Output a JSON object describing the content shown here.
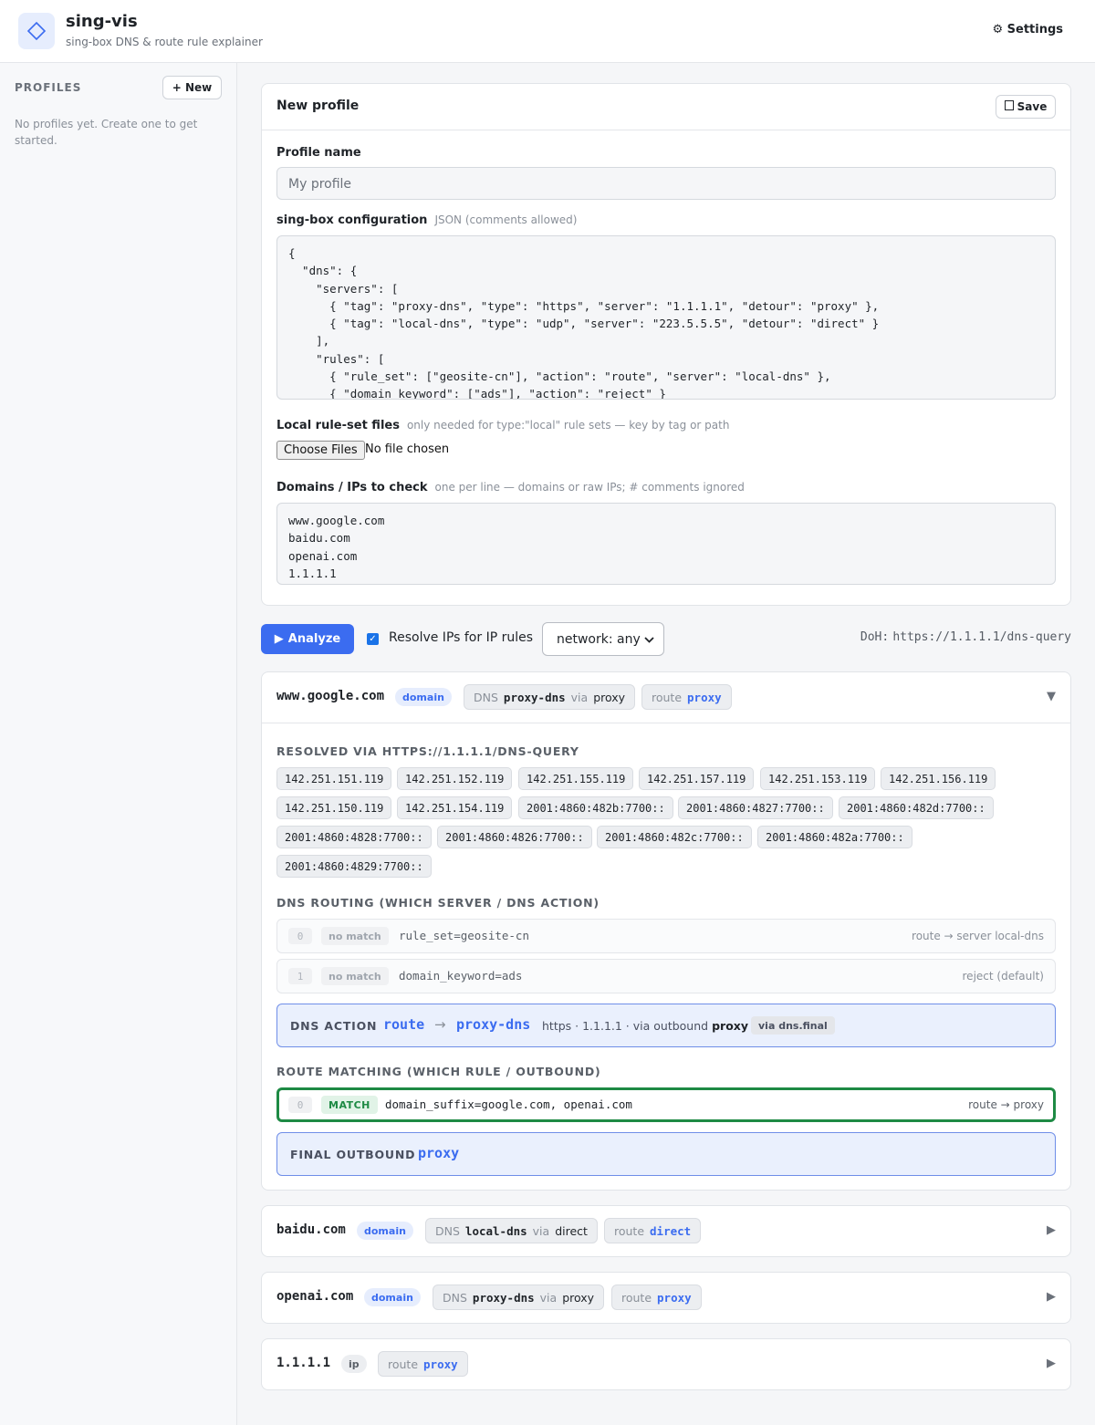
{
  "app": {
    "title": "sing-vis",
    "subtitle": "sing-box DNS & route rule explainer",
    "settings_label": "⚙ Settings",
    "logo_icon": "diamond-icon"
  },
  "sidebar": {
    "title": "PROFILES",
    "new_label": "+ New",
    "empty_text": "No profiles yet. Create one to get started."
  },
  "profile": {
    "title": "New profile",
    "save_label": "Save",
    "name_label": "Profile name",
    "name_placeholder": "My profile",
    "config_label": "sing-box configuration",
    "config_hint": "JSON (comments allowed)",
    "config_text": "{\n  \"dns\": {\n    \"servers\": [\n      { \"tag\": \"proxy-dns\", \"type\": \"https\", \"server\": \"1.1.1.1\", \"detour\": \"proxy\" },\n      { \"tag\": \"local-dns\", \"type\": \"udp\", \"server\": \"223.5.5.5\", \"detour\": \"direct\" }\n    ],\n    \"rules\": [\n      { \"rule_set\": [\"geosite-cn\"], \"action\": \"route\", \"server\": \"local-dns\" },\n      { \"domain_keyword\": [\"ads\"], \"action\": \"reject\" }",
    "ruleset_label": "Local rule-set files",
    "ruleset_hint": "only needed for type:\"local\" rule sets — key by tag or path",
    "choose_files_label": "Choose Files",
    "no_file_label": "No file chosen",
    "domains_label": "Domains / IPs to check",
    "domains_hint": "one per line — domains or raw IPs; # comments ignored",
    "domains_text": "www.google.com\nbaidu.com\nopenai.com\n1.1.1.1"
  },
  "toolbar": {
    "analyze_label": "Analyze",
    "resolve_label": "Resolve IPs for IP rules",
    "resolve_checked": true,
    "network_value": "network: any",
    "doh_prefix": "DoH:",
    "doh_url": "https://1.1.1.1/dns-query"
  },
  "results": [
    {
      "name": "www.google.com",
      "kind": "domain",
      "dns_label": "DNS",
      "dns_server": "proxy-dns",
      "via_label": "via",
      "dns_detour": "proxy",
      "route_label": "route",
      "route_out": "proxy",
      "expanded": true,
      "resolved_title": "RESOLVED VIA HTTPS://1.1.1.1/DNS-QUERY",
      "ips": [
        "142.251.151.119",
        "142.251.152.119",
        "142.251.155.119",
        "142.251.157.119",
        "142.251.153.119",
        "142.251.156.119",
        "142.251.150.119",
        "142.251.154.119",
        "2001:4860:482b:7700::",
        "2001:4860:4827:7700::",
        "2001:4860:482d:7700::",
        "2001:4860:4828:7700::",
        "2001:4860:4826:7700::",
        "2001:4860:482c:7700::",
        "2001:4860:482a:7700::",
        "2001:4860:4829:7700::"
      ],
      "dns_routing_title": "DNS ROUTING (WHICH SERVER / DNS ACTION)",
      "dns_rules": [
        {
          "idx": "0",
          "status": "no match",
          "cond": "rule_set=geosite-cn",
          "result": "route → server local-dns"
        },
        {
          "idx": "1",
          "status": "no match",
          "cond": "domain_keyword=ads",
          "result": "reject (default)"
        }
      ],
      "dns_action": {
        "label": "DNS ACTION",
        "action": "route",
        "arrow": "→",
        "server": "proxy-dns",
        "meta_prefix": "https · 1.1.1.1 · via outbound",
        "meta_out": "proxy",
        "via_tag": "via dns.final"
      },
      "route_matching_title": "ROUTE MATCHING (WHICH RULE / OUTBOUND)",
      "route_rules": [
        {
          "idx": "0",
          "status": "MATCH",
          "cond": "domain_suffix=google.com, openai.com",
          "result": "route → proxy"
        }
      ],
      "final": {
        "label": "FINAL OUTBOUND",
        "value": "proxy"
      }
    },
    {
      "name": "baidu.com",
      "kind": "domain",
      "dns_label": "DNS",
      "dns_server": "local-dns",
      "via_label": "via",
      "dns_detour": "direct",
      "route_label": "route",
      "route_out": "direct"
    },
    {
      "name": "openai.com",
      "kind": "domain",
      "dns_label": "DNS",
      "dns_server": "proxy-dns",
      "via_label": "via",
      "dns_detour": "proxy",
      "route_label": "route",
      "route_out": "proxy"
    },
    {
      "name": "1.1.1.1",
      "kind": "ip",
      "route_label": "route",
      "route_out": "proxy"
    }
  ],
  "icons": {
    "expanded": "▼",
    "collapsed": "▶",
    "save": "floppy-icon",
    "play": "play-icon"
  },
  "colors": {
    "accent": "#3b6cf0",
    "match": "#1e8a44"
  }
}
